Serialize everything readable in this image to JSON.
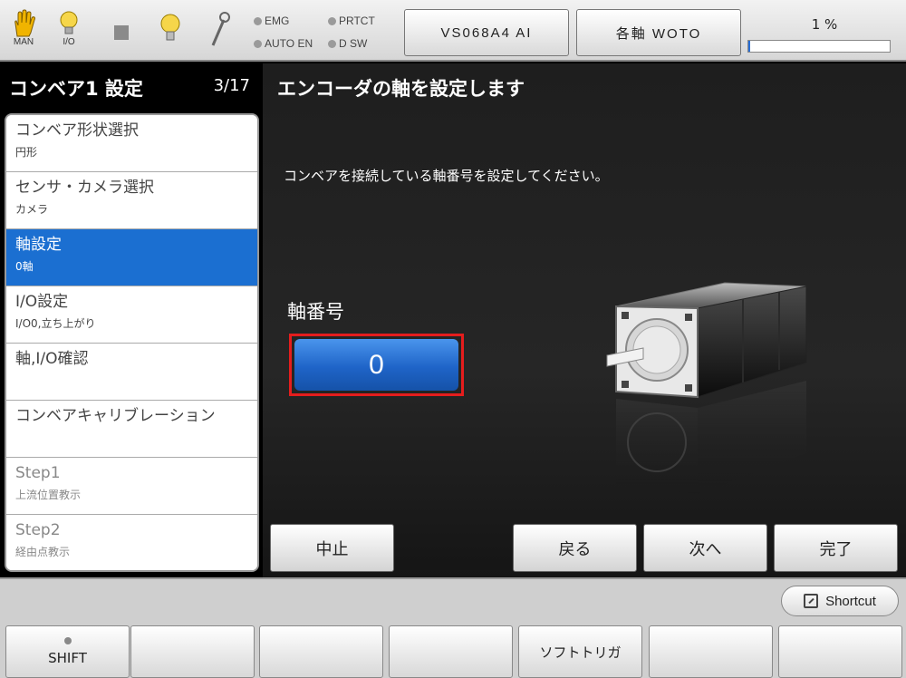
{
  "top_bar": {
    "icons": [
      {
        "name": "hand-icon",
        "label": "MAN"
      },
      {
        "name": "bulb-icon",
        "label": "I/O"
      },
      {
        "name": "square-icon",
        "label": ""
      },
      {
        "name": "lamp-icon",
        "label": ""
      },
      {
        "name": "wrench-icon",
        "label": ""
      }
    ],
    "indicators": [
      {
        "label": "EMG"
      },
      {
        "label": "PRTCT"
      },
      {
        "label": "AUTO EN"
      },
      {
        "label": "D SW"
      }
    ],
    "robot_button": "VS068A4 AI",
    "axis_button": "各軸 WOTO",
    "progress_text": "1 %",
    "progress_value": 0.01,
    "accent_color": "#2a6fd6"
  },
  "sidebar": {
    "title": "コンベア1 設定",
    "page_counter": "3/17",
    "steps": [
      {
        "label": "コンベア形状選択",
        "value": "円形",
        "state": "normal"
      },
      {
        "label": "センサ・カメラ選択",
        "value": "カメラ",
        "state": "normal"
      },
      {
        "label": "軸設定",
        "value": "0軸",
        "state": "active"
      },
      {
        "label": "I/O設定",
        "value": "I/O0,立ち上がり",
        "state": "normal"
      },
      {
        "label": "軸,I/O確認",
        "value": "",
        "state": "normal"
      },
      {
        "label": "コンベアキャリブレーション",
        "value": "",
        "state": "normal"
      },
      {
        "label": "Step1",
        "value": "上流位置教示",
        "state": "dim"
      },
      {
        "label": "Step2",
        "value": "経由点教示",
        "state": "dim"
      }
    ],
    "active_color": "#1b6fd1"
  },
  "main": {
    "title": "エンコーダの軸を設定します",
    "instruction": "コンベアを接続している軸番号を設定してください。",
    "axis_label": "軸番号",
    "axis_value": "0",
    "buttons": {
      "abort": "中止",
      "back": "戻る",
      "next": "次へ",
      "finish": "完了"
    }
  },
  "bottom_bar": {
    "shortcut_label": "Shortcut",
    "function_keys": [
      "SHIFT",
      "",
      "",
      "",
      "ソフトトリガ",
      "",
      ""
    ]
  }
}
